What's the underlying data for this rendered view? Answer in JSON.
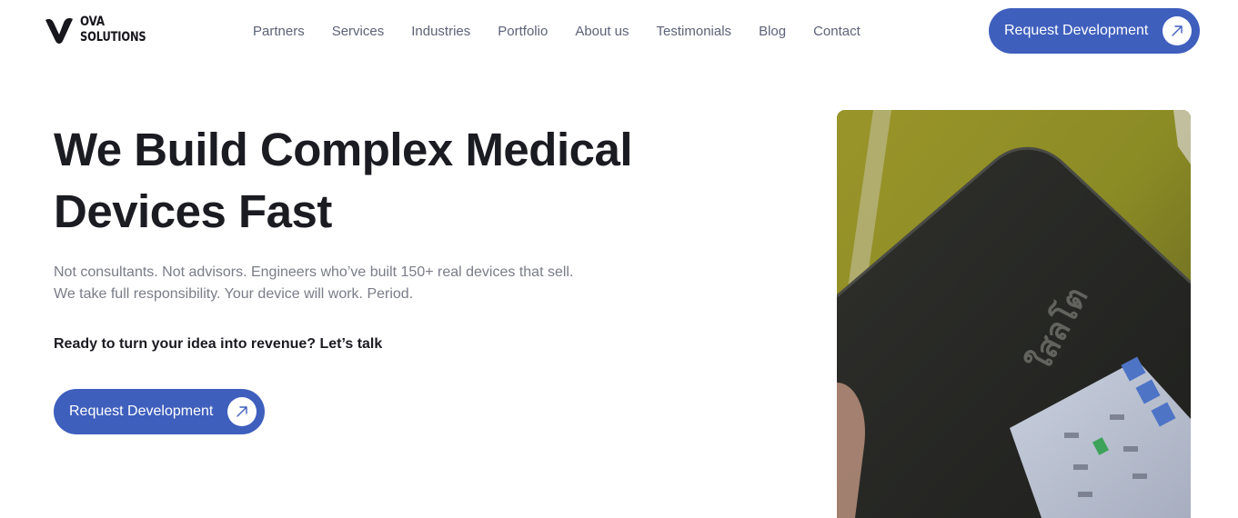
{
  "brand": {
    "line1": "OVA",
    "line2": "SOLUTIONS",
    "logo_icon": "v-logo-icon"
  },
  "nav": {
    "items": [
      {
        "label": "Partners"
      },
      {
        "label": "Services"
      },
      {
        "label": "Industries"
      },
      {
        "label": "Portfolio"
      },
      {
        "label": "About us"
      },
      {
        "label": "Testimonials"
      },
      {
        "label": "Blog"
      },
      {
        "label": "Contact"
      }
    ]
  },
  "header": {
    "cta_label": "Request Development",
    "cta_icon": "arrow-up-right-icon"
  },
  "hero": {
    "title_line1": "We Build Complex Medical",
    "title_line2": "Devices Fast",
    "sub_line1": "Not consultants. Not advisors. Engineers who’ve built 150+ real devices that sell.",
    "sub_line2": "We take full responsibility. Your device will work. Period.",
    "cta_text": "Ready to turn your idea into revenue? Let’s talk",
    "cta_label": "Request Development",
    "cta_icon": "arrow-up-right-icon",
    "image_icon": "medical-device-photo"
  },
  "colors": {
    "accent": "#3f5fbd",
    "text": "#1b1b22",
    "muted": "#7a7d88",
    "nav": "#5d6379"
  }
}
